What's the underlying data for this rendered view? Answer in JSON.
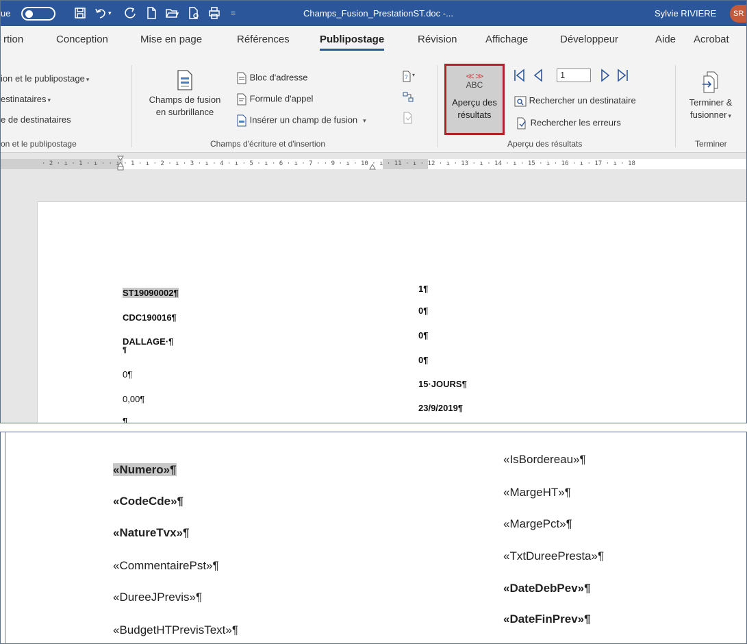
{
  "titlebar": {
    "left_cut": "ue",
    "filename": "Champs_Fusion_PrestationST.doc  -...",
    "qat_more": "=",
    "user": "Sylvie RIVIERE",
    "initials": "SR"
  },
  "tabs": [
    {
      "label": "rtion"
    },
    {
      "label": "Conception"
    },
    {
      "label": "Mise en page"
    },
    {
      "label": "Références"
    },
    {
      "label": "Publipostage",
      "active": true
    },
    {
      "label": "Révision"
    },
    {
      "label": "Affichage"
    },
    {
      "label": "Développeur"
    },
    {
      "label": "Aide"
    },
    {
      "label": "Acrobat"
    }
  ],
  "ribbon": {
    "start_group": {
      "item1": "ion et le publipostage",
      "item2": "estinataires",
      "item3": "e de destinataires",
      "label": "on et le publipostage"
    },
    "write_group": {
      "highlight_line1": "Champs de fusion",
      "highlight_line2": "en surbrillance",
      "address_block": "Bloc d'adresse",
      "greeting": "Formule d'appel",
      "insert_field": "Insérer un champ de fusion",
      "label": "Champs d'écriture et d'insertion"
    },
    "preview_group": {
      "abc": "ABC",
      "chevrons": "≪ ≫",
      "preview_line1": "Aperçu des",
      "preview_line2": "résultats",
      "record": "1",
      "find_recipient": "Rechercher un destinataire",
      "check_errors": "Rechercher les erreurs",
      "label": "Aperçu des résultats"
    },
    "finish_group": {
      "finish_line1": "Terminer &",
      "finish_line2": "fusionner",
      "label": "Terminer"
    }
  },
  "ruler": {
    "text": "· 2 · ı · 1 · ı ·     · ı · 1 · ı · 2 · ı · 3 · ı · 4 · ı · 5 · ı · 6 · ı · 7 ·             · 9 · ı · 10 · ı · 11 · ı · 12 · ı · 13 · ı · 14 · ı · 15 · ı · 16 · ı · 17 · ı · 18"
  },
  "document_preview": {
    "left": [
      "ST19090002¶",
      "CDC190016¶",
      "DALLAGE·¶",
      "¶",
      "0¶",
      "0,00¶",
      "¶"
    ],
    "right": [
      "1¶",
      "0¶",
      "0¶",
      "0¶",
      "15·JOURS¶",
      "23/9/2019¶"
    ]
  },
  "merge_fields": {
    "left": [
      "«Numero»¶",
      "«CodeCde»¶",
      "«NatureTvx»¶",
      "«CommentairePst»¶",
      "«DureeJPrevis»¶",
      "«BudgetHTPrevisText»¶"
    ],
    "right": [
      "«IsBordereau»¶",
      "«MargeHT»¶",
      "«MargePct»¶",
      "«TxtDureePresta»¶",
      "«DateDebPev»¶",
      "«DateFinPrev»¶"
    ]
  },
  "colors": {
    "titlebar": "#2b579a",
    "highlight_border": "#b2212a",
    "field_highlight": "#c8c8c8"
  }
}
